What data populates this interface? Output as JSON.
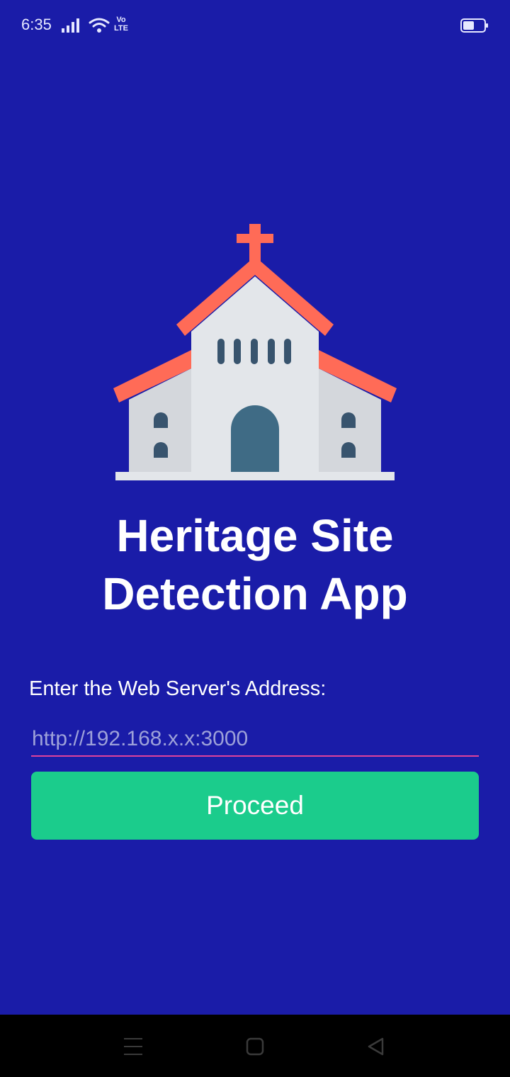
{
  "status_bar": {
    "time": "6:35",
    "network_badge_top": "Vo",
    "network_badge_bottom": "LTE",
    "icons": [
      "signal-icon",
      "wifi-icon",
      "volte-icon",
      "battery-icon"
    ]
  },
  "logo": {
    "icon": "church-icon",
    "colors": {
      "roof": "#ff6b57",
      "wall_center": "#e3e6ea",
      "wall_side": "#d4d7dc",
      "windows": "#38546e",
      "door": "#3f6b85"
    }
  },
  "title": {
    "line1": "Heritage Site",
    "line2": "Detection App"
  },
  "form": {
    "label": "Enter the Web Server's Address:",
    "input_value": "",
    "input_placeholder": "http://192.168.x.x:3000",
    "button_label": "Proceed"
  },
  "nav_bar": {
    "icons": [
      "menu-icon",
      "home-icon",
      "back-icon"
    ]
  },
  "colors": {
    "background": "#1a1ca8",
    "button": "#1bcc8c",
    "input_underline": "#e0429c"
  }
}
